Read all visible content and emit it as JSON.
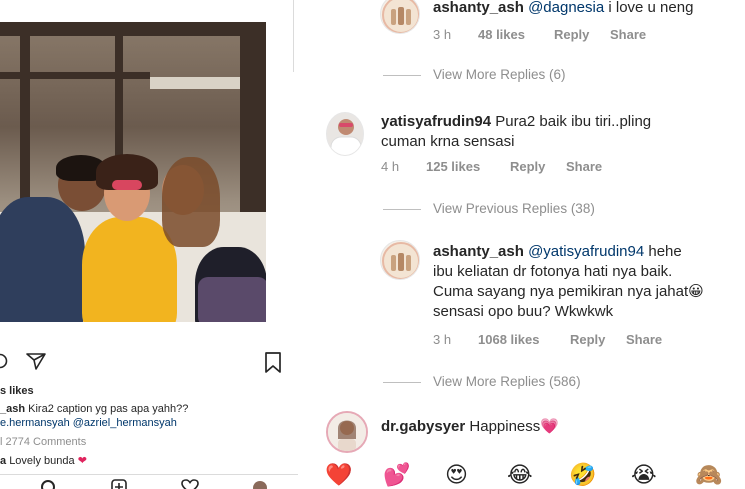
{
  "post": {
    "likes_label": "s likes",
    "caption_user": "_ash",
    "caption_text": "Kira2 caption yg pas apa yahh??",
    "caption_mentions": "e.hermansyah @azriel_hermansyah",
    "view_comments": "l 2774 Comments",
    "comment_user": "a",
    "comment_text": "Lovely bunda"
  },
  "comments": [
    {
      "username": "ashanty_ash",
      "mention": "@dagnesia",
      "text": "i love u neng",
      "time": "3 h",
      "likes": "48 likes",
      "reply": "Reply",
      "share": "Share"
    },
    {
      "view_more": "View More Replies (6)"
    },
    {
      "username": "yatisyafrudin94",
      "text_line1": "Pura2 baik ibu tiri..pling",
      "text_line2": "cuman krna sensasi",
      "time": "4 h",
      "likes": "125 likes",
      "reply": "Reply",
      "share": "Share"
    },
    {
      "view_previous": "View Previous Replies (38)"
    },
    {
      "username": "ashanty_ash",
      "mention": "@yatisyafrudin94",
      "text_line1_suffix": "hehe",
      "text_line2": "ibu keliatan dr fotonya hati nya baik.",
      "text_line3": "Cuma sayang nya pemikiran nya jahat😀",
      "text_line4": "sensasi opo buu? Wkwkwk",
      "time": "3 h",
      "likes": "1068 likes",
      "reply": "Reply",
      "share": "Share"
    },
    {
      "view_more": "View More Replies (586)"
    },
    {
      "username": "dr.gabysyer",
      "text": "Happiness💗"
    }
  ],
  "emoji_bar": [
    "❤️",
    "💕",
    "😍",
    "😂",
    "🤣",
    "😭",
    "🙈"
  ],
  "colors": {
    "text": "#262626",
    "muted": "#8e8e8e",
    "mention": "#00376b",
    "heart": "#ed4956"
  }
}
